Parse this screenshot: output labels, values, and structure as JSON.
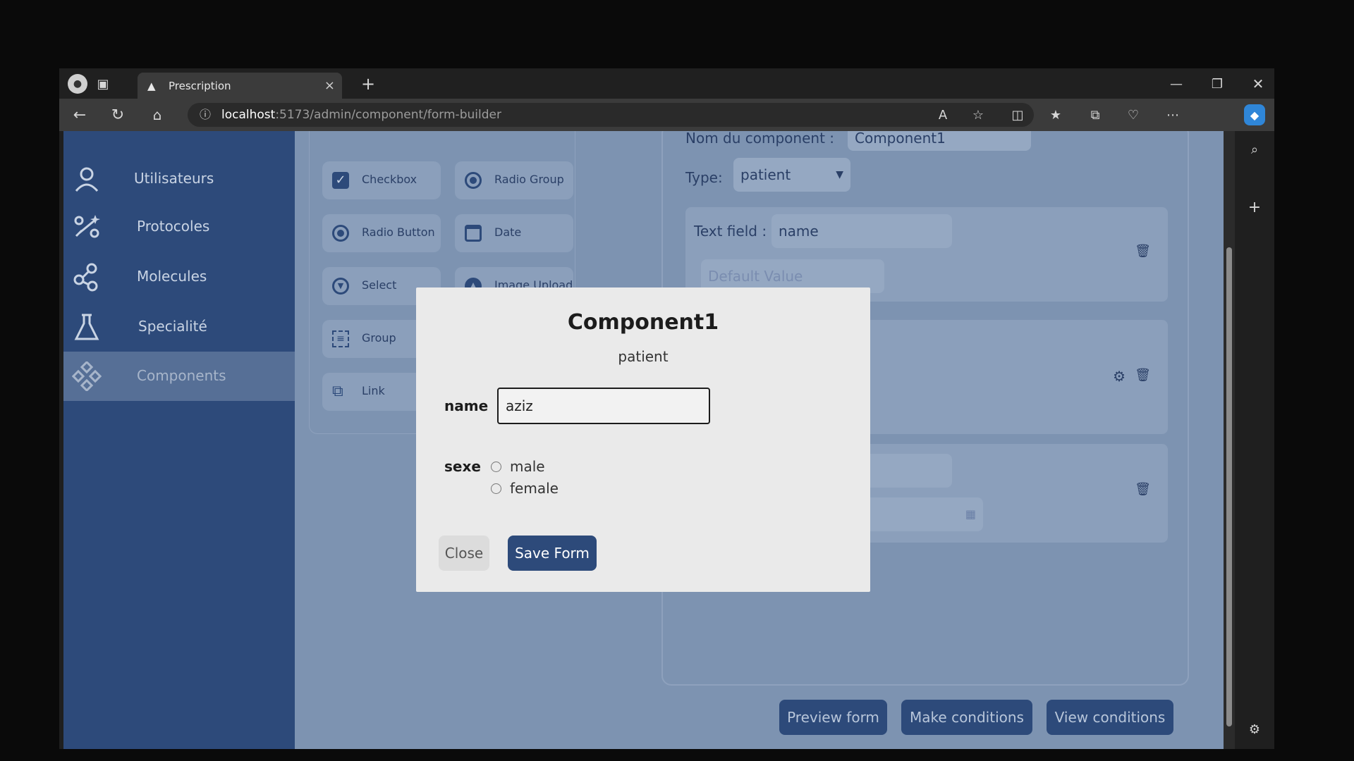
{
  "browser": {
    "tab_title": "Prescription",
    "url_host": "localhost",
    "url_path": ":5173/admin/component/form-builder"
  },
  "sidebar": {
    "items": [
      {
        "label": "Utilisateurs",
        "icon": "user-icon"
      },
      {
        "label": "Protocoles",
        "icon": "protocol-icon"
      },
      {
        "label": "Molecules",
        "icon": "molecule-icon"
      },
      {
        "label": "Specialité",
        "icon": "flask-icon"
      },
      {
        "label": "Components",
        "icon": "components-icon",
        "active": true
      }
    ]
  },
  "palette": {
    "items": [
      {
        "label": "Checkbox",
        "icon": "checkbox-icon"
      },
      {
        "label": "Radio Group",
        "icon": "radio-group-icon"
      },
      {
        "label": "Radio Button",
        "icon": "radio-button-icon"
      },
      {
        "label": "Date",
        "icon": "calendar-icon"
      },
      {
        "label": "Select",
        "icon": "select-icon"
      },
      {
        "label": "Image Upload",
        "icon": "upload-icon"
      },
      {
        "label": "Group",
        "icon": "group-icon"
      },
      {
        "label": "Link",
        "icon": "link-icon"
      }
    ]
  },
  "builder": {
    "component_name_label": "Nom du component :",
    "component_name_value": "Component1",
    "type_label": "Type:",
    "type_value": "patient",
    "field1_label": "Text field :",
    "field1_value": "name",
    "field1_default_placeholder": "Default Value"
  },
  "bottom_buttons": {
    "preview": "Preview form",
    "conditions": "Make conditions",
    "view": "View conditions"
  },
  "modal": {
    "title": "Component1",
    "subtitle": "patient",
    "name_label": "name",
    "name_value": "aziz",
    "sexe_label": "sexe",
    "options": [
      "male",
      "female"
    ],
    "close": "Close",
    "save": "Save Form"
  },
  "colors": {
    "sidebar": "#2d4a7a",
    "overlay_page": "#7d93b1",
    "primary": "#2d4a7a"
  }
}
